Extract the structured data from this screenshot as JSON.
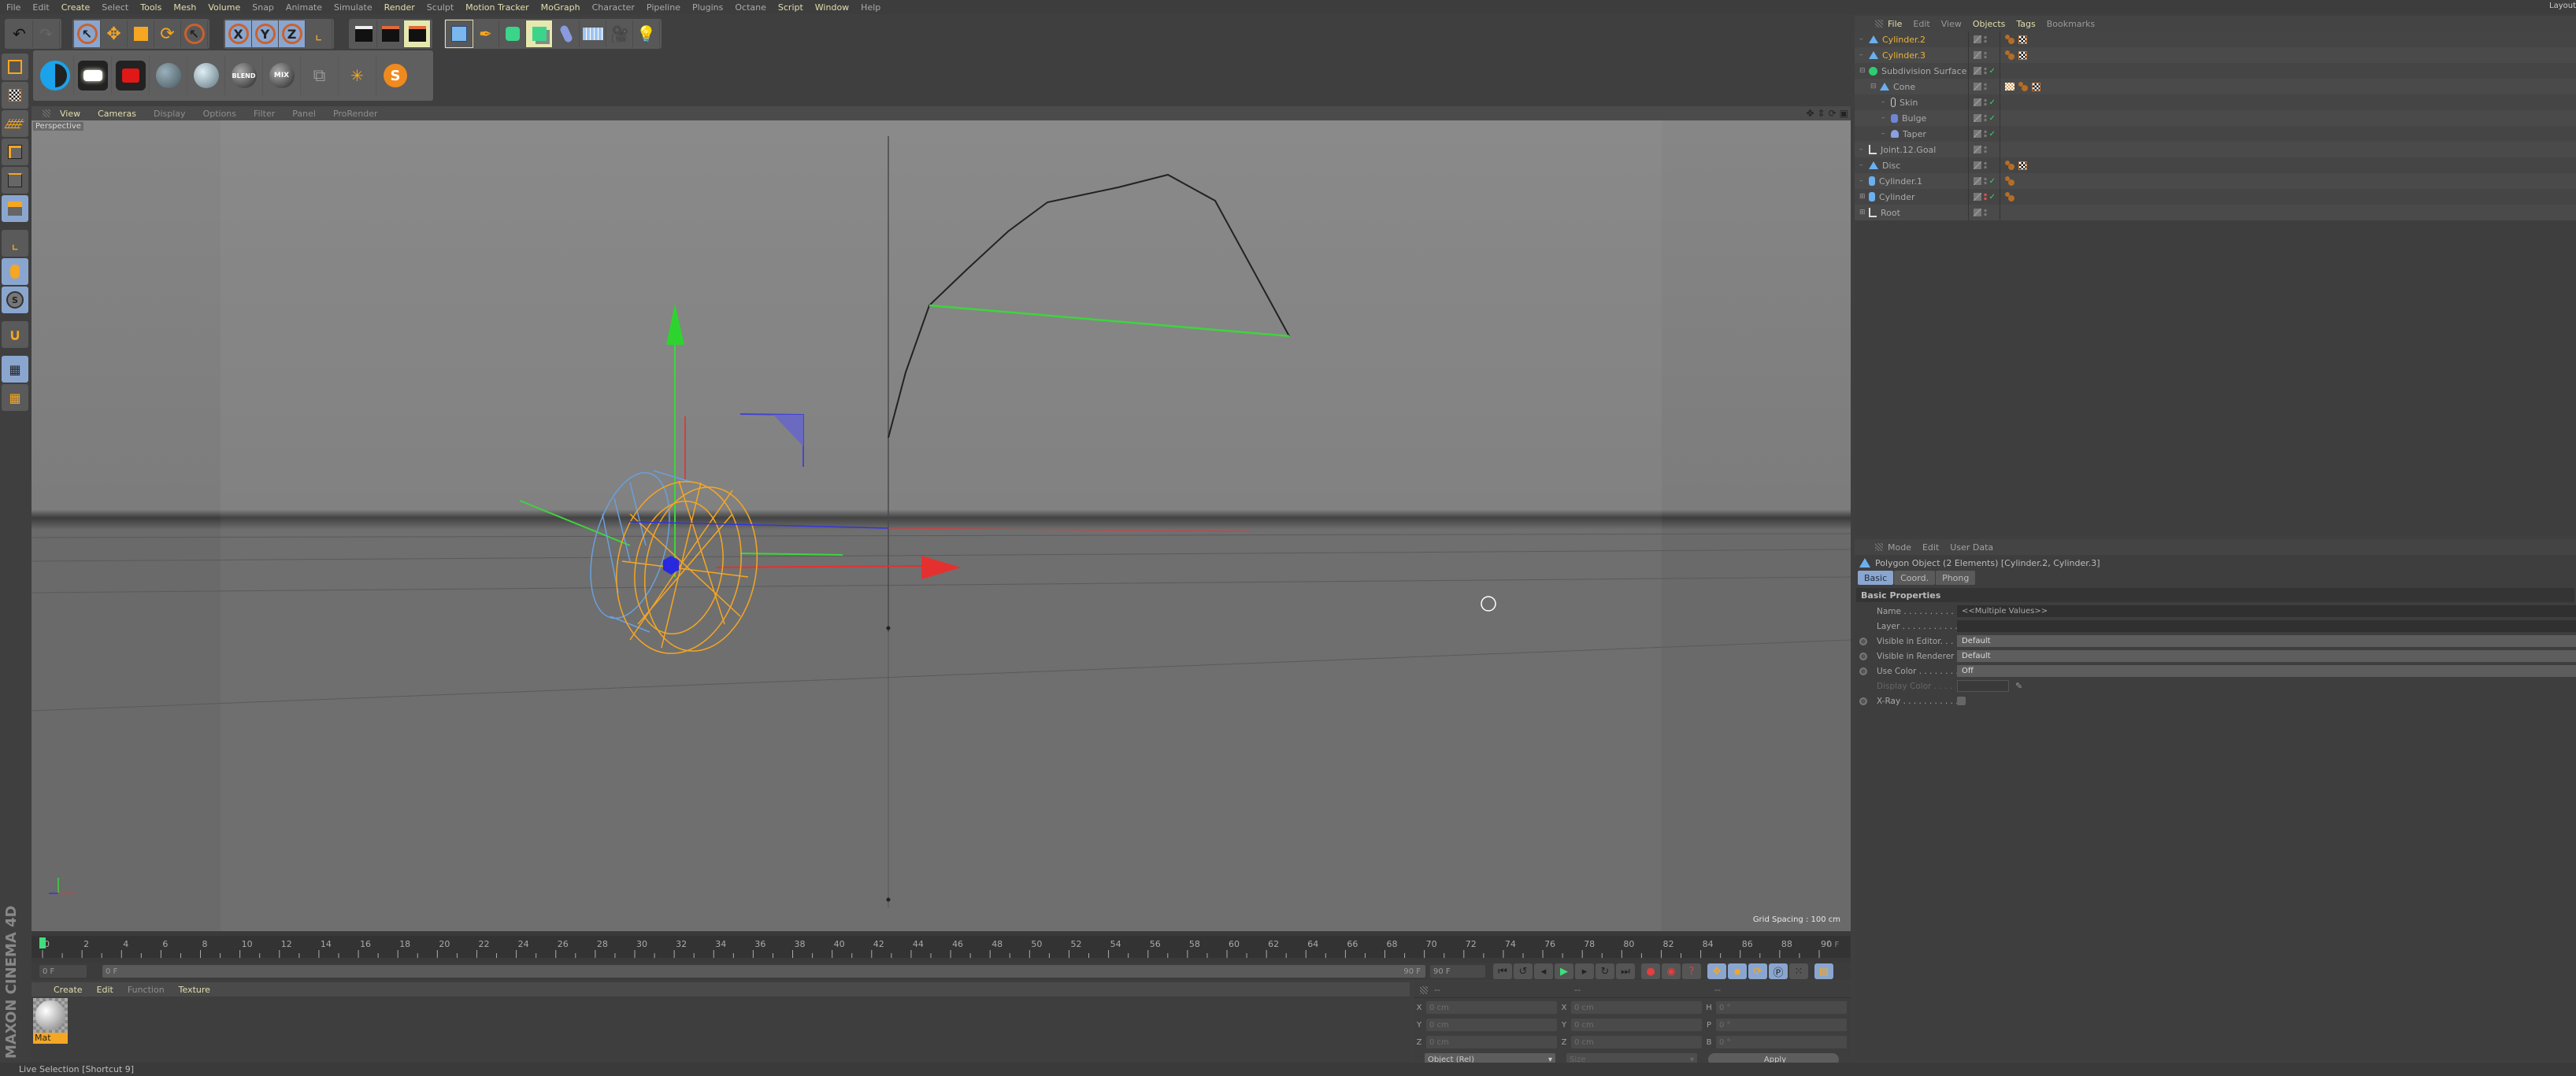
{
  "app": {
    "title": "Cinema 4D",
    "brand": "MAXON CINEMA 4D",
    "layout_label": "Layout"
  },
  "menubar": {
    "items": [
      {
        "label": "File",
        "hl": false
      },
      {
        "label": "Edit",
        "hl": false
      },
      {
        "label": "Create",
        "hl": true
      },
      {
        "label": "Select",
        "hl": false
      },
      {
        "label": "Tools",
        "hl": true
      },
      {
        "label": "Mesh",
        "hl": true
      },
      {
        "label": "Volume",
        "hl": true
      },
      {
        "label": "Snap",
        "hl": false
      },
      {
        "label": "Animate",
        "hl": false
      },
      {
        "label": "Simulate",
        "hl": false
      },
      {
        "label": "Render",
        "hl": true
      },
      {
        "label": "Sculpt",
        "hl": false
      },
      {
        "label": "Motion Tracker",
        "hl": true
      },
      {
        "label": "MoGraph",
        "hl": true
      },
      {
        "label": "Character",
        "hl": false
      },
      {
        "label": "Pipeline",
        "hl": false
      },
      {
        "label": "Plugins",
        "hl": false
      },
      {
        "label": "Octane",
        "hl": false
      },
      {
        "label": "Script",
        "hl": true
      },
      {
        "label": "Window",
        "hl": true
      },
      {
        "label": "Help",
        "hl": false
      }
    ]
  },
  "toolbar": {
    "undo_icon": "undo-icon",
    "redo_icon": "redo-icon",
    "tools": [
      "live-selection",
      "move",
      "scale",
      "rotate",
      "last-tool"
    ],
    "axes": [
      "X",
      "Y",
      "Z"
    ],
    "coord_system_icon": "world-coordinate-icon",
    "render": [
      "render-view",
      "render-to-picture-viewer",
      "render-settings"
    ],
    "objects": [
      "cube",
      "pen-spline",
      "subdivision-surface",
      "cloner",
      "deformer-bend",
      "floor",
      "camera",
      "light"
    ]
  },
  "material_toolbar": {
    "blend_label": "BLEND",
    "mix_label": "MIX",
    "s_label": "S"
  },
  "left_tools": [
    "make-editable",
    "texture-mode",
    "workplane",
    "points-mode",
    "edges-mode",
    "polygons-mode",
    "axis-mode",
    "tweak-mode",
    "solo-mode",
    "snap",
    "locked-workplane",
    "planar-workplane"
  ],
  "viewport": {
    "menu": [
      {
        "label": "View",
        "hl": true
      },
      {
        "label": "Cameras",
        "hl": true
      },
      {
        "label": "Display",
        "hl": false
      },
      {
        "label": "Options",
        "hl": false
      },
      {
        "label": "Filter",
        "hl": false
      },
      {
        "label": "Panel",
        "hl": false
      },
      {
        "label": "ProRender",
        "hl": false
      }
    ],
    "camera_label": "Perspective",
    "grid_spacing": "Grid Spacing : 100 cm",
    "nav_icons": [
      "move-view-icon",
      "zoom-view-icon",
      "rotate-view-icon",
      "maximize-view-icon"
    ]
  },
  "timeline": {
    "ticks": [
      "0",
      "2",
      "4",
      "6",
      "8",
      "10",
      "12",
      "14",
      "16",
      "18",
      "20",
      "22",
      "24",
      "26",
      "28",
      "30",
      "32",
      "34",
      "36",
      "38",
      "40",
      "42",
      "44",
      "46",
      "48",
      "50",
      "52",
      "54",
      "56",
      "58",
      "60",
      "62",
      "64",
      "66",
      "68",
      "70",
      "72",
      "74",
      "76",
      "78",
      "80",
      "82",
      "84",
      "86",
      "88",
      "90"
    ],
    "current_frame": "0 F",
    "end_frame_display": "0 F",
    "min_frame": "0 F",
    "range_start": "0 F",
    "range_end": "90 F",
    "max_frame": "90 F",
    "accent": "#3ee07a"
  },
  "material_manager": {
    "menu": [
      {
        "label": "Create",
        "dim": false
      },
      {
        "label": "Edit",
        "dim": false
      },
      {
        "label": "Function",
        "dim": true
      },
      {
        "label": "Texture",
        "dim": false
      }
    ],
    "materials": [
      {
        "name": "Mat",
        "selected": true
      }
    ]
  },
  "coordinates": {
    "headers": [
      "--",
      "--",
      "--"
    ],
    "rows": [
      {
        "l1": "X",
        "v1": "0 cm",
        "l2": "X",
        "v2": "0 cm",
        "l3": "H",
        "v3": "0 °"
      },
      {
        "l1": "Y",
        "v1": "0 cm",
        "l2": "Y",
        "v2": "0 cm",
        "l3": "P",
        "v3": "0 °"
      },
      {
        "l1": "Z",
        "v1": "0 cm",
        "l2": "Z",
        "v2": "0 cm",
        "l3": "B",
        "v3": "0 °"
      }
    ],
    "mode_select": "Object (Rel)",
    "size_select": "Size",
    "apply_label": "Apply"
  },
  "object_manager": {
    "menu": [
      {
        "label": "File",
        "hl": true
      },
      {
        "label": "Edit",
        "hl": false
      },
      {
        "label": "View",
        "hl": false
      },
      {
        "label": "Objects",
        "hl": true
      },
      {
        "label": "Tags",
        "hl": true
      },
      {
        "label": "Bookmarks",
        "hl": false
      }
    ],
    "objects": [
      {
        "name": "Cylinder.2",
        "icon": "polygon-object-icon",
        "depth": 0,
        "selected": true,
        "expander": "",
        "check": false,
        "tags": [
          "material",
          "texture"
        ]
      },
      {
        "name": "Cylinder.3",
        "icon": "polygon-object-icon",
        "depth": 0,
        "selected": true,
        "expander": "",
        "check": false,
        "tags": [
          "material",
          "texture"
        ]
      },
      {
        "name": "Subdivision Surface",
        "icon": "subdivision-surface-icon",
        "depth": 0,
        "selected": false,
        "expander": "-",
        "check": true,
        "tags": []
      },
      {
        "name": "Cone",
        "icon": "polygon-object-icon",
        "depth": 1,
        "selected": false,
        "expander": "-",
        "check": false,
        "tags": [
          "weight",
          "material",
          "texture"
        ]
      },
      {
        "name": "Skin",
        "icon": "skin-deformer-icon",
        "depth": 2,
        "selected": false,
        "expander": "",
        "check": true,
        "tags": []
      },
      {
        "name": "Bulge",
        "icon": "bulge-deformer-icon",
        "depth": 2,
        "selected": false,
        "expander": "",
        "check": true,
        "tags": []
      },
      {
        "name": "Taper",
        "icon": "taper-deformer-icon",
        "depth": 2,
        "selected": false,
        "expander": "",
        "check": true,
        "tags": []
      },
      {
        "name": "Joint.12.Goal",
        "icon": "null-object-icon",
        "depth": 0,
        "selected": false,
        "expander": "",
        "check": false,
        "tags": []
      },
      {
        "name": "Disc",
        "icon": "polygon-object-icon",
        "depth": 0,
        "selected": false,
        "expander": "",
        "check": false,
        "tags": [
          "material",
          "texture"
        ]
      },
      {
        "name": "Cylinder.1",
        "icon": "cylinder-icon",
        "depth": 0,
        "selected": false,
        "expander": "",
        "check": true,
        "tags": [
          "material"
        ]
      },
      {
        "name": "Cylinder",
        "icon": "cylinder-icon",
        "depth": 0,
        "selected": false,
        "expander": "+",
        "check": true,
        "tags": [
          "material"
        ]
      },
      {
        "name": "Root",
        "icon": "null-object-icon",
        "depth": 0,
        "selected": false,
        "expander": "+",
        "check": false,
        "tags": []
      }
    ]
  },
  "attribute_manager": {
    "menu": [
      "Mode",
      "Edit",
      "User Data"
    ],
    "title": "Polygon Object (2 Elements) [Cylinder.2, Cylinder.3]",
    "tabs": [
      {
        "label": "Basic",
        "active": true
      },
      {
        "label": "Coord.",
        "active": false
      },
      {
        "label": "Phong",
        "active": false
      }
    ],
    "section": "Basic Properties",
    "fields": {
      "name_label": "Name . . . . . . . . . . . .",
      "name_value": "<<Multiple Values>>",
      "layer_label": "Layer . . . . . . . . . . . .",
      "layer_value": "",
      "vis_editor_label": "Visible in Editor. . .",
      "vis_editor_value": "Default",
      "vis_render_label": "Visible in Renderer",
      "vis_render_value": "Default",
      "use_color_label": "Use Color . . . . . . . .",
      "use_color_value": "Off",
      "display_color_label": "Display Color . . . .",
      "xray_label": "X-Ray . . . . . . . . . . . .",
      "xray_checked": false
    }
  },
  "status": {
    "text": "Live Selection [Shortcut 9]"
  },
  "colors": {
    "selected_object": "#e8b43a",
    "menu_highlight": "#e2dfae",
    "active_tab": "#8aa6cf",
    "x_axis": "#e53030",
    "y_axis": "#2ed42e",
    "z_axis": "#3434e0",
    "wire_selected": "#f5a623",
    "wire_other": "#6aa0dc"
  }
}
